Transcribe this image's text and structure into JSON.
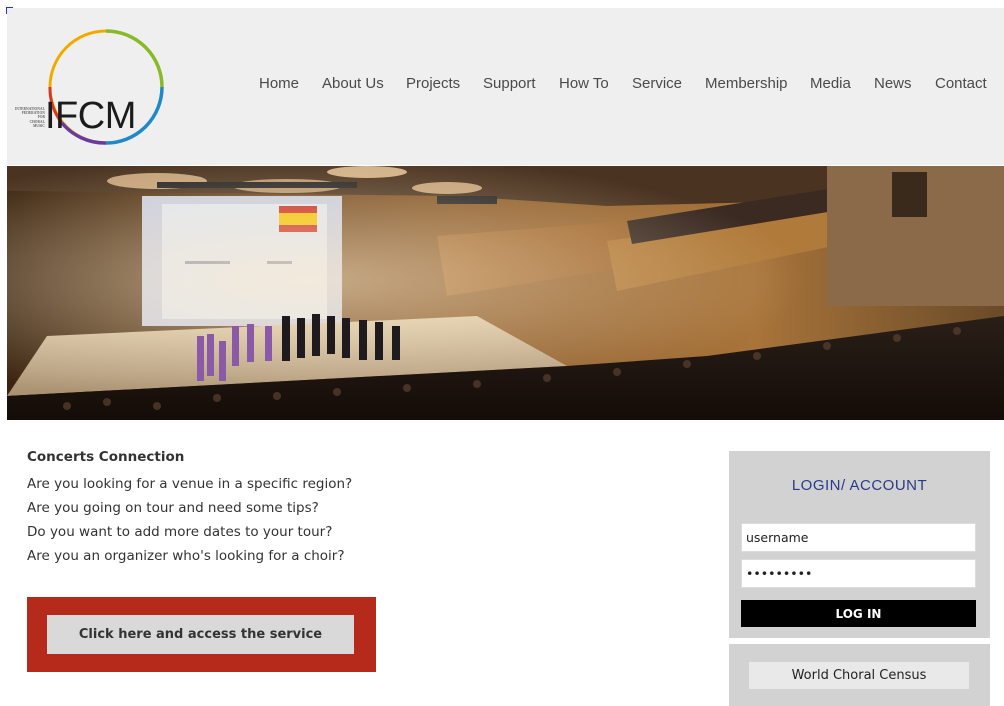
{
  "logo": {
    "org_lines": [
      "International",
      "Federation",
      "for",
      "Choral",
      "Music"
    ],
    "acronym": "IFCM"
  },
  "nav": {
    "items": [
      {
        "label": "Home"
      },
      {
        "label": "About Us"
      },
      {
        "label": "Projects"
      },
      {
        "label": "Support"
      },
      {
        "label": "How To"
      },
      {
        "label": "Service"
      },
      {
        "label": "Membership"
      },
      {
        "label": "Media"
      },
      {
        "label": "News"
      },
      {
        "label": "Contact"
      }
    ]
  },
  "main": {
    "title": "Concerts Connection",
    "lines": [
      "Are you looking for a venue in a specific region?",
      "Are you going on tour and need some tips?",
      "Do you want to add more dates to your tour?",
      "Are you an organizer who's looking for a choir?"
    ],
    "cta_label": "Click here and access the service"
  },
  "login": {
    "title": "LOGIN/ ACCOUNT",
    "username_value": "username",
    "password_value": "•••••••••",
    "button_label": "LOG IN"
  },
  "census": {
    "button_label": "World Choral Census"
  },
  "colors": {
    "accent_red": "#b52a1a",
    "login_title_blue": "#2a3a8a",
    "header_bg": "#efefef",
    "panel_bg": "#d2d2d2"
  }
}
